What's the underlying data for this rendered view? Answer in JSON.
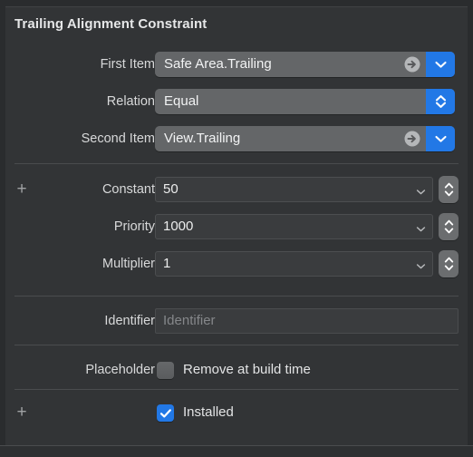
{
  "panel": {
    "title": "Trailing Alignment Constraint",
    "accent_color": "#2278e6",
    "background_color": "#323436",
    "field_color": "#646668",
    "text_color": "#e6e7e8"
  },
  "rows": {
    "first_item": {
      "label": "First Item",
      "value": "Safe Area.Trailing",
      "jump_icon": "arrow-right-circle-icon",
      "menu_icon": "chevron-down-icon"
    },
    "relation": {
      "label": "Relation",
      "value": "Equal",
      "menu_icon": "chevron-up-down-icon"
    },
    "second_item": {
      "label": "Second Item",
      "value": "View.Trailing",
      "jump_icon": "arrow-right-circle-icon",
      "menu_icon": "chevron-down-icon"
    },
    "constant": {
      "label": "Constant",
      "value": "50",
      "add_icon": "plus-icon",
      "menu_icon": "chevron-down-icon",
      "stepper_icon": "stepper-icon"
    },
    "priority": {
      "label": "Priority",
      "value": "1000",
      "menu_icon": "chevron-down-icon",
      "stepper_icon": "stepper-icon"
    },
    "multiplier": {
      "label": "Multiplier",
      "value": "1",
      "menu_icon": "chevron-down-icon",
      "stepper_icon": "stepper-icon"
    },
    "identifier": {
      "label": "Identifier",
      "value": "",
      "placeholder": "Identifier"
    },
    "placeholder": {
      "label": "Placeholder",
      "checkbox_label": "Remove at build time",
      "checked": false
    },
    "installed": {
      "label": "",
      "checkbox_label": "Installed",
      "checked": true,
      "add_icon": "plus-icon"
    }
  }
}
